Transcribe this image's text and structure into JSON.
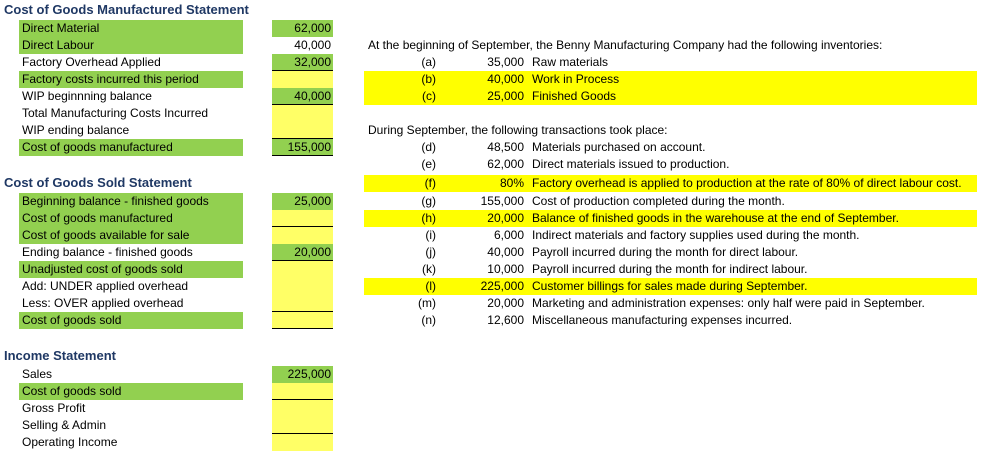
{
  "cogm": {
    "title": "Cost of Goods Manufactured Statement",
    "rows": [
      {
        "label": "Direct Material",
        "value": "62,000"
      },
      {
        "label": "Direct Labour",
        "value": "40,000"
      },
      {
        "label": "Factory Overhead Applied",
        "value": "32,000"
      },
      {
        "label": "Factory costs incurred this period",
        "value": ""
      },
      {
        "label": "WIP beginnning balance",
        "value": "40,000"
      },
      {
        "label": "Total Manufacturing Costs Incurred",
        "value": ""
      },
      {
        "label": "WIP ending balance",
        "value": ""
      },
      {
        "label": "Cost of goods manufactured",
        "value": "155,000"
      }
    ]
  },
  "cogs": {
    "title": "Cost of Goods Sold Statement",
    "rows": [
      {
        "label": "Beginning balance - finished goods",
        "value": "25,000"
      },
      {
        "label": "Cost of goods manufactured",
        "value": ""
      },
      {
        "label": "Cost of goods available for sale",
        "value": ""
      },
      {
        "label": "Ending balance - finished goods",
        "value": "20,000"
      },
      {
        "label": "Unadjusted cost of goods sold",
        "value": ""
      },
      {
        "label": "Add: UNDER applied overhead",
        "value": ""
      },
      {
        "label": "Less: OVER applied overhead",
        "value": ""
      },
      {
        "label": "Cost of goods sold",
        "value": ""
      }
    ]
  },
  "income": {
    "title": "Income Statement",
    "rows": [
      {
        "label": "Sales",
        "value": "225,000"
      },
      {
        "label": "Cost of goods sold",
        "value": ""
      },
      {
        "label": "Gross Profit",
        "value": ""
      },
      {
        "label": "Selling & Admin",
        "value": ""
      },
      {
        "label": "Operating Income",
        "value": ""
      }
    ]
  },
  "problem": {
    "intro": "At the beginning of September, the Benny Manufacturing Company had the following inventories:",
    "inventories": [
      {
        "letter": "(a)",
        "amount": "35,000",
        "desc": "Raw materials"
      },
      {
        "letter": "(b)",
        "amount": "40,000",
        "desc": "Work in Process"
      },
      {
        "letter": "(c)",
        "amount": "25,000",
        "desc": "Finished Goods"
      }
    ],
    "transactions_intro": "During September, the following transactions took place:",
    "transactions": [
      {
        "letter": "(d)",
        "amount": "48,500",
        "desc": "Materials purchased on account."
      },
      {
        "letter": "(e)",
        "amount": "62,000",
        "desc": "Direct materials issued to production."
      },
      {
        "letter": "(f)",
        "amount": "80%",
        "desc": "Factory overhead is applied to production at the rate of 80% of direct labour cost."
      },
      {
        "letter": "(g)",
        "amount": "155,000",
        "desc": "Cost of production completed during the month."
      },
      {
        "letter": "(h)",
        "amount": "20,000",
        "desc": "Balance of finished goods in the warehouse at the end of September."
      },
      {
        "letter": "(i)",
        "amount": "6,000",
        "desc": "Indirect materials and factory supplies used during the month."
      },
      {
        "letter": "(j)",
        "amount": "40,000",
        "desc": "Payroll incurred during the month for direct labour."
      },
      {
        "letter": "(k)",
        "amount": "10,000",
        "desc": "Payroll incurred during the month for indirect labour."
      },
      {
        "letter": "(l)",
        "amount": "225,000",
        "desc": "Customer billings for sales made during September."
      },
      {
        "letter": "(m)",
        "amount": "20,000",
        "desc": "Marketing and administration expenses: only half were paid in September."
      },
      {
        "letter": "(n)",
        "amount": "12,600",
        "desc": "Miscellaneous manufacturing expenses incurred."
      }
    ]
  }
}
